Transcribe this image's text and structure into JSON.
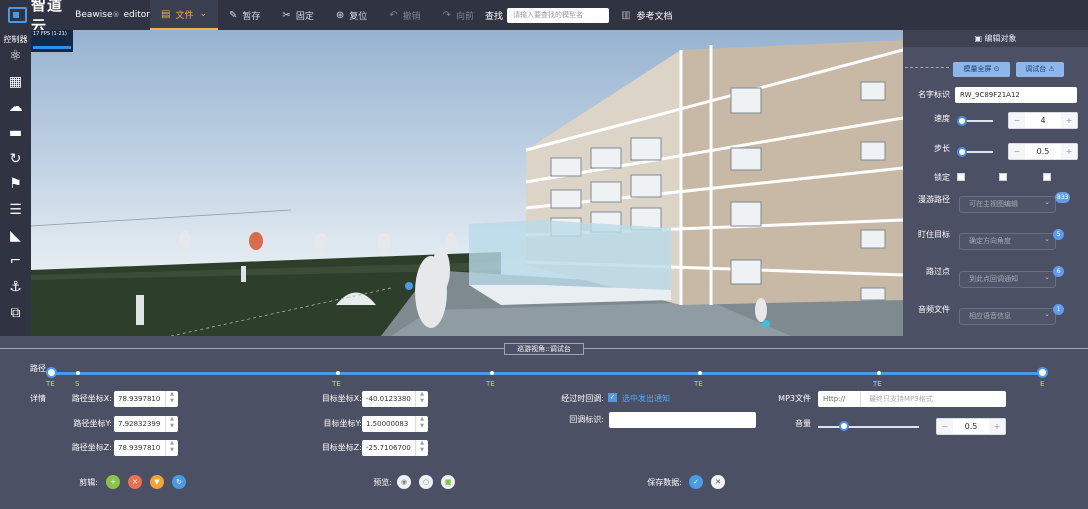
{
  "topbar": {
    "logo_cn": "智道云",
    "logo_en": "Beawise",
    "logo_sup": "®",
    "logo_editor": "editor",
    "menu": [
      {
        "label": "文件",
        "icon": "file-icon",
        "active": true
      },
      {
        "label": "暂存",
        "icon": "pen-icon",
        "active": false
      },
      {
        "label": "固定",
        "icon": "pin-icon",
        "active": false
      },
      {
        "label": "复位",
        "icon": "reset-icon",
        "active": false
      },
      {
        "label": "撤销",
        "icon": "undo-icon",
        "active": false
      },
      {
        "label": "向前",
        "icon": "redo-icon",
        "active": false
      }
    ],
    "search_label": "查找",
    "search_placeholder": "请输入要查找的模型名",
    "docs_label": "参考文档"
  },
  "sidebar": {
    "title": "控制器",
    "icons": [
      "atom-icon",
      "checker-icon",
      "weather-icon",
      "clapper-icon",
      "rotate-icon",
      "flag-icon",
      "document-icon",
      "car-icon",
      "route-icon",
      "anchor-icon",
      "layers-icon"
    ]
  },
  "viewport": {
    "fps": "17 FPS (1-21)"
  },
  "right_panel": {
    "header": "编辑对象",
    "btn_model_roam": "模量全屏",
    "btn_debug": "调试台",
    "name_label": "名字标识",
    "name_value": "RW_9C89F21A12",
    "speed_label": "速度",
    "speed_value": "4",
    "step_label": "步长",
    "step_value": "0.5",
    "lock_label": "锁定",
    "path_label": "漫游路径",
    "path_placeholder": "可在主视图编辑",
    "path_badge": "833",
    "target_label": "盯住目标",
    "target_placeholder": "确定方向角度",
    "waypoint_label": "路过点",
    "waypoint_placeholder": "到此点回调通知",
    "waypoint_badge": "6",
    "target_badge": "5",
    "audio_label": "音频文件",
    "audio_placeholder": "相应语音信息",
    "audio_badge": "1"
  },
  "bottom": {
    "title": "巡游视角::调试台",
    "path_label": "路径",
    "track_labels": [
      "TE",
      "S",
      "TE",
      "TE",
      "TE",
      "TE",
      "E"
    ],
    "detail_label": "详情",
    "path_x_label": "路径坐标X:",
    "path_x": "78.9397810",
    "path_y_label": "路径坐标Y:",
    "path_y": "7.92832399",
    "path_z_label": "路径坐标Z:",
    "path_z": "78.9397810",
    "target_x_label": "目标坐标X:",
    "target_x": "-40.0123380",
    "target_y_label": "目标坐标Y:",
    "target_y": "1.50000083",
    "target_z_label": "目标坐标Z:",
    "target_z": "-25.7106700",
    "callback_label": "经过时回调:",
    "callback_check": "选中发出通知",
    "callback_id_label": "回调标识:",
    "mp3_label": "MP3文件",
    "mp3_prefix": "Http://",
    "mp3_placeholder": "最终只支持MP3格式",
    "volume_label": "音量",
    "volume_value": "0.5",
    "edit_label": "剪辑:",
    "preview_label": "预览:",
    "save_label": "保存数据:"
  },
  "colors": {
    "accent": "#4a9be6",
    "active_menu": "#f2b34a",
    "track_label": "#b6db7a"
  }
}
